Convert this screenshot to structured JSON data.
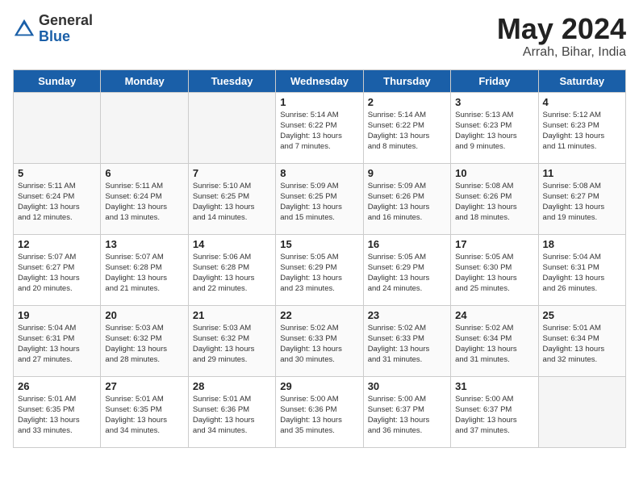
{
  "header": {
    "logo_general": "General",
    "logo_blue": "Blue",
    "title": "May 2024",
    "location": "Arrah, Bihar, India"
  },
  "days_of_week": [
    "Sunday",
    "Monday",
    "Tuesday",
    "Wednesday",
    "Thursday",
    "Friday",
    "Saturday"
  ],
  "weeks": [
    [
      {
        "day": "",
        "empty": true
      },
      {
        "day": "",
        "empty": true
      },
      {
        "day": "",
        "empty": true
      },
      {
        "day": "1",
        "info": "Sunrise: 5:14 AM\nSunset: 6:22 PM\nDaylight: 13 hours\nand 7 minutes."
      },
      {
        "day": "2",
        "info": "Sunrise: 5:14 AM\nSunset: 6:22 PM\nDaylight: 13 hours\nand 8 minutes."
      },
      {
        "day": "3",
        "info": "Sunrise: 5:13 AM\nSunset: 6:23 PM\nDaylight: 13 hours\nand 9 minutes."
      },
      {
        "day": "4",
        "info": "Sunrise: 5:12 AM\nSunset: 6:23 PM\nDaylight: 13 hours\nand 11 minutes."
      }
    ],
    [
      {
        "day": "5",
        "info": "Sunrise: 5:11 AM\nSunset: 6:24 PM\nDaylight: 13 hours\nand 12 minutes."
      },
      {
        "day": "6",
        "info": "Sunrise: 5:11 AM\nSunset: 6:24 PM\nDaylight: 13 hours\nand 13 minutes."
      },
      {
        "day": "7",
        "info": "Sunrise: 5:10 AM\nSunset: 6:25 PM\nDaylight: 13 hours\nand 14 minutes."
      },
      {
        "day": "8",
        "info": "Sunrise: 5:09 AM\nSunset: 6:25 PM\nDaylight: 13 hours\nand 15 minutes."
      },
      {
        "day": "9",
        "info": "Sunrise: 5:09 AM\nSunset: 6:26 PM\nDaylight: 13 hours\nand 16 minutes."
      },
      {
        "day": "10",
        "info": "Sunrise: 5:08 AM\nSunset: 6:26 PM\nDaylight: 13 hours\nand 18 minutes."
      },
      {
        "day": "11",
        "info": "Sunrise: 5:08 AM\nSunset: 6:27 PM\nDaylight: 13 hours\nand 19 minutes."
      }
    ],
    [
      {
        "day": "12",
        "info": "Sunrise: 5:07 AM\nSunset: 6:27 PM\nDaylight: 13 hours\nand 20 minutes."
      },
      {
        "day": "13",
        "info": "Sunrise: 5:07 AM\nSunset: 6:28 PM\nDaylight: 13 hours\nand 21 minutes."
      },
      {
        "day": "14",
        "info": "Sunrise: 5:06 AM\nSunset: 6:28 PM\nDaylight: 13 hours\nand 22 minutes."
      },
      {
        "day": "15",
        "info": "Sunrise: 5:05 AM\nSunset: 6:29 PM\nDaylight: 13 hours\nand 23 minutes."
      },
      {
        "day": "16",
        "info": "Sunrise: 5:05 AM\nSunset: 6:29 PM\nDaylight: 13 hours\nand 24 minutes."
      },
      {
        "day": "17",
        "info": "Sunrise: 5:05 AM\nSunset: 6:30 PM\nDaylight: 13 hours\nand 25 minutes."
      },
      {
        "day": "18",
        "info": "Sunrise: 5:04 AM\nSunset: 6:31 PM\nDaylight: 13 hours\nand 26 minutes."
      }
    ],
    [
      {
        "day": "19",
        "info": "Sunrise: 5:04 AM\nSunset: 6:31 PM\nDaylight: 13 hours\nand 27 minutes."
      },
      {
        "day": "20",
        "info": "Sunrise: 5:03 AM\nSunset: 6:32 PM\nDaylight: 13 hours\nand 28 minutes."
      },
      {
        "day": "21",
        "info": "Sunrise: 5:03 AM\nSunset: 6:32 PM\nDaylight: 13 hours\nand 29 minutes."
      },
      {
        "day": "22",
        "info": "Sunrise: 5:02 AM\nSunset: 6:33 PM\nDaylight: 13 hours\nand 30 minutes."
      },
      {
        "day": "23",
        "info": "Sunrise: 5:02 AM\nSunset: 6:33 PM\nDaylight: 13 hours\nand 31 minutes."
      },
      {
        "day": "24",
        "info": "Sunrise: 5:02 AM\nSunset: 6:34 PM\nDaylight: 13 hours\nand 31 minutes."
      },
      {
        "day": "25",
        "info": "Sunrise: 5:01 AM\nSunset: 6:34 PM\nDaylight: 13 hours\nand 32 minutes."
      }
    ],
    [
      {
        "day": "26",
        "info": "Sunrise: 5:01 AM\nSunset: 6:35 PM\nDaylight: 13 hours\nand 33 minutes."
      },
      {
        "day": "27",
        "info": "Sunrise: 5:01 AM\nSunset: 6:35 PM\nDaylight: 13 hours\nand 34 minutes."
      },
      {
        "day": "28",
        "info": "Sunrise: 5:01 AM\nSunset: 6:36 PM\nDaylight: 13 hours\nand 34 minutes."
      },
      {
        "day": "29",
        "info": "Sunrise: 5:00 AM\nSunset: 6:36 PM\nDaylight: 13 hours\nand 35 minutes."
      },
      {
        "day": "30",
        "info": "Sunrise: 5:00 AM\nSunset: 6:37 PM\nDaylight: 13 hours\nand 36 minutes."
      },
      {
        "day": "31",
        "info": "Sunrise: 5:00 AM\nSunset: 6:37 PM\nDaylight: 13 hours\nand 37 minutes."
      },
      {
        "day": "",
        "empty": true
      }
    ]
  ]
}
